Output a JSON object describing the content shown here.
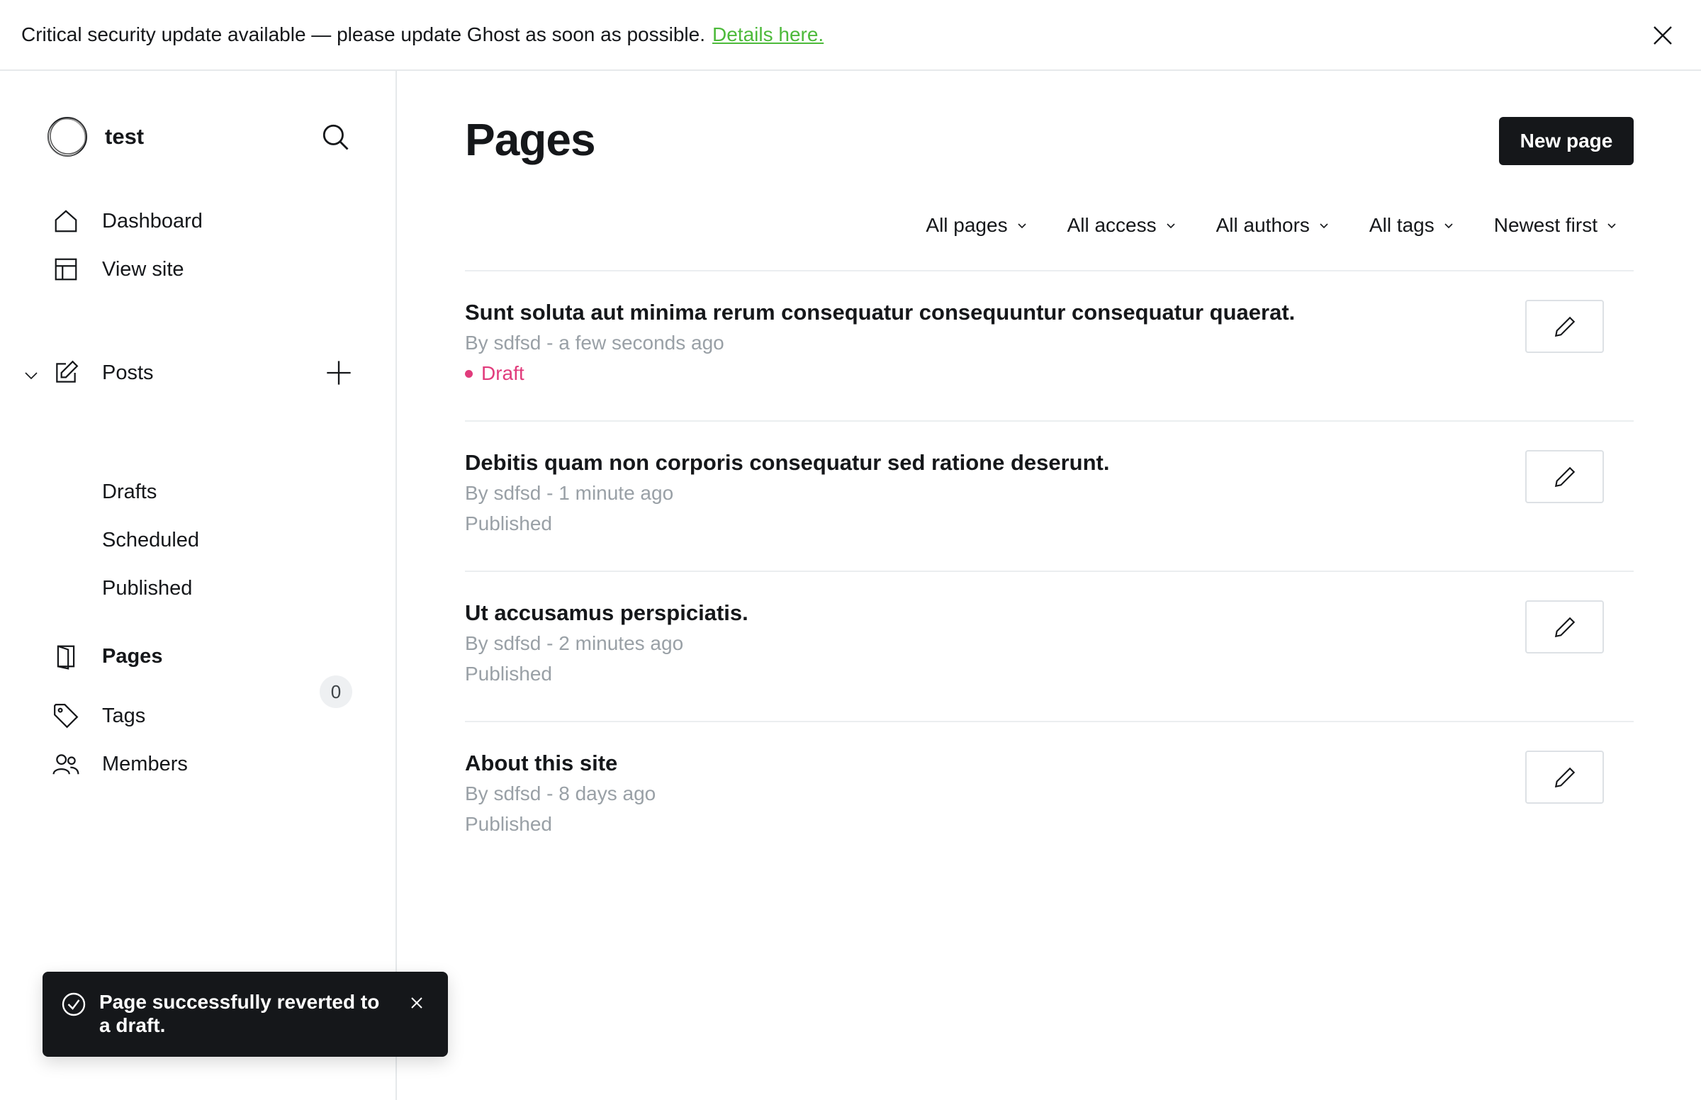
{
  "banner": {
    "message": "Critical security update available — please update Ghost as soon as possible.",
    "link": "Details here."
  },
  "sidebar": {
    "site_name": "test",
    "items": {
      "dashboard": "Dashboard",
      "view_site": "View site",
      "posts": "Posts",
      "drafts": "Drafts",
      "scheduled": "Scheduled",
      "published": "Published",
      "pages": "Pages",
      "tags": "Tags",
      "members": "Members"
    },
    "members_count": "0"
  },
  "main": {
    "title": "Pages",
    "new_button": "New page",
    "filters": [
      "All pages",
      "All access",
      "All authors",
      "All tags",
      "Newest first"
    ],
    "rows": [
      {
        "title": "Sunt soluta aut minima rerum consequatur consequuntur consequatur quaerat.",
        "meta": "By sdfsd - a few seconds ago",
        "status": "Draft"
      },
      {
        "title": "Debitis quam non corporis consequatur sed ratione deserunt.",
        "meta": "By sdfsd - 1 minute ago",
        "status": "Published"
      },
      {
        "title": "Ut accusamus perspiciatis.",
        "meta": "By sdfsd - 2 minutes ago",
        "status": "Published"
      },
      {
        "title": "About this site",
        "meta": "By sdfsd - 8 days ago",
        "status": "Published"
      }
    ]
  },
  "toast": {
    "message": "Page successfully reverted to a draft."
  },
  "colors": {
    "draft": "#e13c7c",
    "link": "#4dba3b",
    "dark": "#15171a"
  }
}
